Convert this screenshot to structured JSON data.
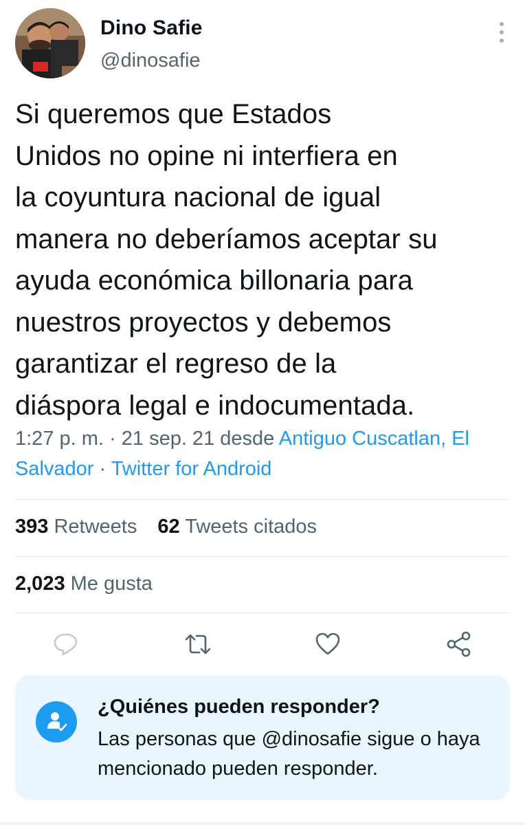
{
  "author": {
    "display_name": "Dino Safie",
    "handle": "@dinosafie"
  },
  "tweet": {
    "text": "Si queremos que Estados\nUnidos no opine ni interfiera en\nla coyuntura nacional de igual\nmanera no deberíamos aceptar su\nayuda económica billonaria para\nnuestros proyectos y debemos\ngarantizar el regreso de la\ndiáspora legal e indocumentada.",
    "time": "1:27 p. m.",
    "sep1": " · ",
    "date": "21 sep. 21",
    "from_word": " desde ",
    "location": "Antiguo Cuscatlan, El Salvador",
    "sep2": " · ",
    "source": "Twitter for Android"
  },
  "stats": {
    "retweets_count": "393",
    "retweets_label": "Retweets",
    "quotes_count": "62",
    "quotes_label": "Tweets citados",
    "likes_count": "2,023",
    "likes_label": "Me gusta"
  },
  "actions": [
    "reply-icon",
    "retweet-icon",
    "like-icon",
    "share-icon"
  ],
  "reply_settings": {
    "title": "¿Quiénes pueden responder?",
    "description": "Las personas que @dinosafie sigue o haya mencionado pueden responder."
  },
  "colors": {
    "accent": "#1d9bf0",
    "text_primary": "#0f1419",
    "text_secondary": "#536471",
    "card_bg": "#eaf6fd",
    "icon_gray": "#536471"
  }
}
